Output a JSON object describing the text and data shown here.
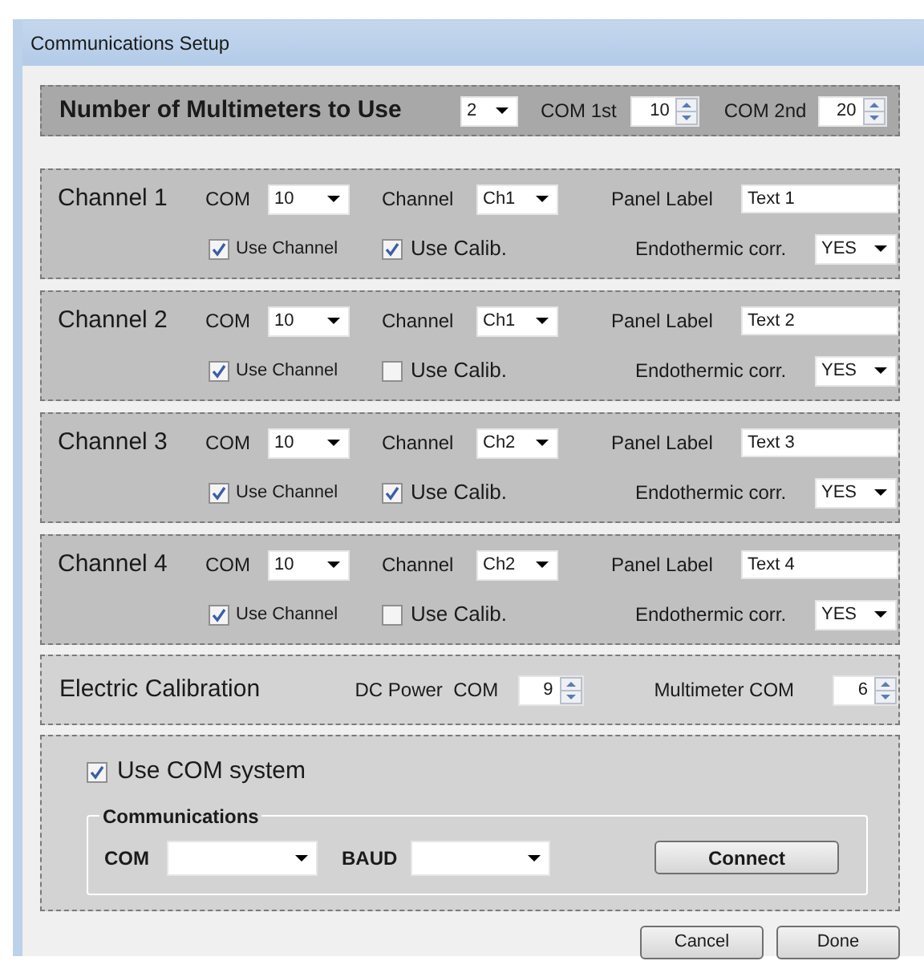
{
  "window": {
    "title": "Communications Setup"
  },
  "multimeters": {
    "label": "Number of Multimeters to Use",
    "count": "2",
    "com_1st": {
      "label": "COM 1st",
      "value": "10"
    },
    "com_2nd": {
      "label": "COM 2nd",
      "value": "20"
    }
  },
  "channels": [
    {
      "title": "Channel 1",
      "com_label": "COM",
      "com": "10",
      "channel_label": "Channel",
      "channel": "Ch1",
      "panel_label_label": "Panel Label",
      "panel_label": "Text 1",
      "use_channel": {
        "label": "Use Channel",
        "checked": true
      },
      "use_calib": {
        "label": "Use Calib.",
        "checked": true
      },
      "endothermic_label": "Endothermic corr.",
      "endothermic": "YES"
    },
    {
      "title": "Channel 2",
      "com_label": "COM",
      "com": "10",
      "channel_label": "Channel",
      "channel": "Ch1",
      "panel_label_label": "Panel Label",
      "panel_label": "Text 2",
      "use_channel": {
        "label": "Use Channel",
        "checked": true
      },
      "use_calib": {
        "label": "Use Calib.",
        "checked": false
      },
      "endothermic_label": "Endothermic corr.",
      "endothermic": "YES"
    },
    {
      "title": "Channel 3",
      "com_label": "COM",
      "com": "10",
      "channel_label": "Channel",
      "channel": "Ch2",
      "panel_label_label": "Panel Label",
      "panel_label": "Text 3",
      "use_channel": {
        "label": "Use Channel",
        "checked": true
      },
      "use_calib": {
        "label": "Use Calib.",
        "checked": true
      },
      "endothermic_label": "Endothermic corr.",
      "endothermic": "YES"
    },
    {
      "title": "Channel 4",
      "com_label": "COM",
      "com": "10",
      "channel_label": "Channel",
      "channel": "Ch2",
      "panel_label_label": "Panel Label",
      "panel_label": "Text 4",
      "use_channel": {
        "label": "Use Channel",
        "checked": true
      },
      "use_calib": {
        "label": "Use Calib.",
        "checked": false
      },
      "endothermic_label": "Endothermic corr.",
      "endothermic": "YES"
    }
  ],
  "electric_calibration": {
    "title": "Electric Calibration",
    "dc_power_label": "DC Power  COM",
    "dc_power": "9",
    "multimeter_label": "Multimeter COM",
    "multimeter": "6"
  },
  "com_system": {
    "use": {
      "label": "Use COM system",
      "checked": true
    },
    "group_title": "Communications",
    "com_label": "COM",
    "baud_label": "BAUD",
    "connect": "Connect"
  },
  "buttons": [
    "Cancel",
    "Done"
  ]
}
